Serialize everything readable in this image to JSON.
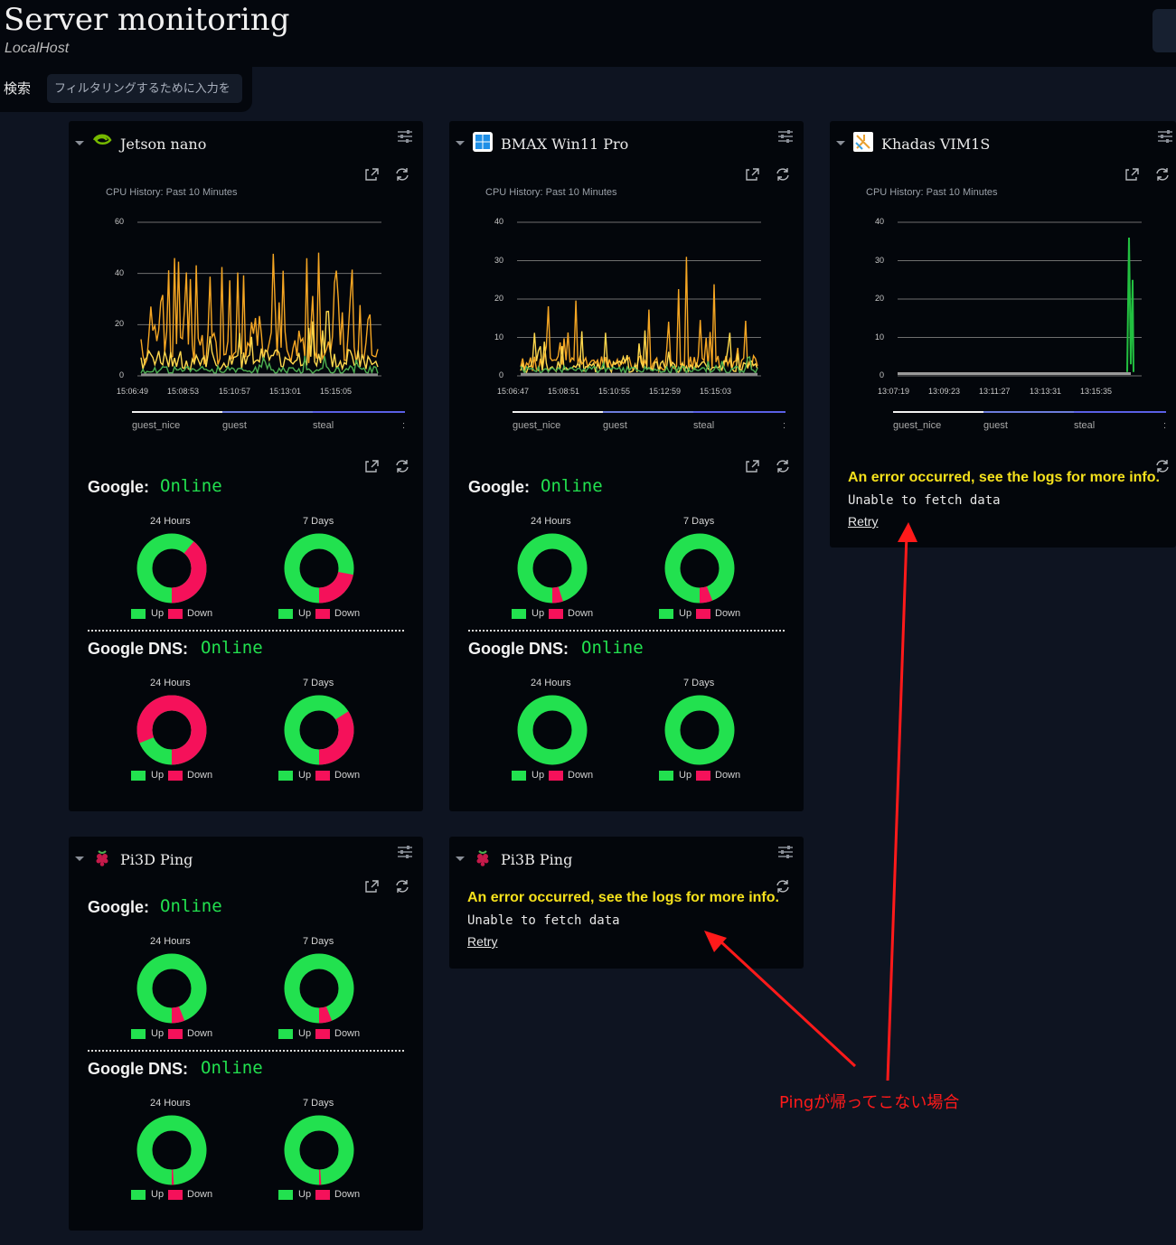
{
  "header": {
    "title": "Server monitoring",
    "subtitle": "LocalHost"
  },
  "search": {
    "label": "検索",
    "placeholder": "フィルタリングするために入力を"
  },
  "colors": {
    "up": "#22e14f",
    "down": "#f5115a",
    "error": "#f5e11c",
    "annotation": "#ff1a1a"
  },
  "cards": {
    "jetson": {
      "title": "Jetson nano",
      "icon": "nvidia-icon",
      "cpu_title": "CPU History: Past 10 Minutes",
      "yticks": [
        "60",
        "40",
        "20",
        "0"
      ],
      "xticks": [
        "15:06:49",
        "15:08:53",
        "15:10:57",
        "15:13:01",
        "15:15:05"
      ],
      "legend": [
        "guest_nice",
        "guest",
        "steal",
        ":"
      ],
      "services": [
        {
          "name": "Google:",
          "status": "Online",
          "p1": "24 Hours",
          "p2": "7 Days",
          "up1": 0.61,
          "up2": 0.78
        },
        {
          "name": "Google DNS:",
          "status": "Online",
          "p1": "24 Hours",
          "p2": "7 Days",
          "up1": 0.19,
          "up2": 0.66
        }
      ]
    },
    "bmax": {
      "title": "BMAX Win11 Pro",
      "icon": "windows-icon",
      "cpu_title": "CPU History: Past 10 Minutes",
      "yticks": [
        "40",
        "30",
        "20",
        "10",
        "0"
      ],
      "xticks": [
        "15:06:47",
        "15:08:51",
        "15:10:55",
        "15:12:59",
        "15:15:03"
      ],
      "legend": [
        "guest_nice",
        "guest",
        "steal",
        ":"
      ],
      "services": [
        {
          "name": "Google:",
          "status": "Online",
          "p1": "24 Hours",
          "p2": "7 Days",
          "up1": 0.95,
          "up2": 0.94
        },
        {
          "name": "Google DNS:",
          "status": "Online",
          "p1": "24 Hours",
          "p2": "7 Days",
          "up1": 1.0,
          "up2": 1.0
        }
      ]
    },
    "khadas": {
      "title": "Khadas VIM1S",
      "icon": "khadas-icon",
      "cpu_title": "CPU History: Past 10 Minutes",
      "yticks": [
        "40",
        "30",
        "20",
        "10",
        "0"
      ],
      "xticks": [
        "13:07:19",
        "13:09:23",
        "13:11:27",
        "13:13:31",
        "13:15:35"
      ],
      "legend": [
        "guest_nice",
        "guest",
        "steal",
        ":"
      ],
      "error_title": "An error occurred, see the logs for more info.",
      "error_msg": "Unable to fetch data",
      "retry": "Retry"
    },
    "pi3d": {
      "title": "Pi3D Ping",
      "icon": "raspberry-pi-icon",
      "services": [
        {
          "name": "Google:",
          "status": "Online",
          "p1": "24 Hours",
          "p2": "7 Days",
          "up1": 0.94,
          "up2": 0.94
        },
        {
          "name": "Google DNS:",
          "status": "Online",
          "p1": "24 Hours",
          "p2": "7 Days",
          "up1": 0.99,
          "up2": 0.99
        }
      ]
    },
    "pi3b": {
      "title": "Pi3B Ping",
      "icon": "raspberry-pi-icon",
      "error_title": "An error occurred, see the logs for more info.",
      "error_msg": "Unable to fetch data",
      "retry": "Retry"
    }
  },
  "legend_labels": {
    "up": "Up",
    "down": "Down"
  },
  "annotation": "Pingが帰ってこない場合"
}
